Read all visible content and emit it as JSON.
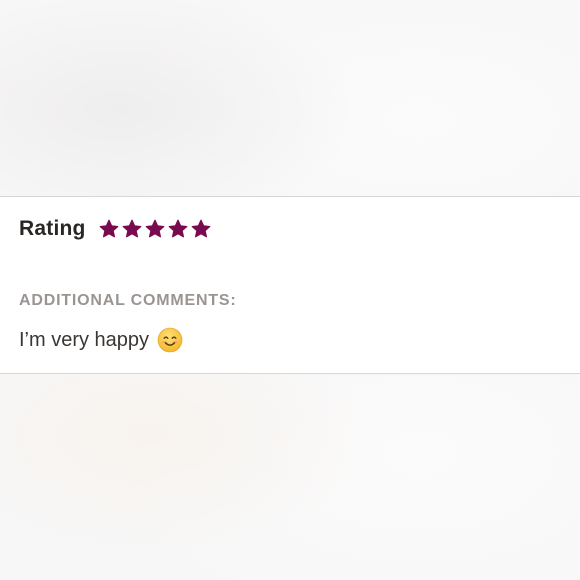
{
  "review": {
    "rating_label": "Rating",
    "rating_value": 5,
    "rating_max": 5,
    "star_icon": "star-icon",
    "star_color": "#7a0a4f",
    "comments_heading": "ADDITIONAL COMMENTS:",
    "comment_text": "I’m very happy",
    "comment_emoji": "smiling-face-emoji"
  }
}
